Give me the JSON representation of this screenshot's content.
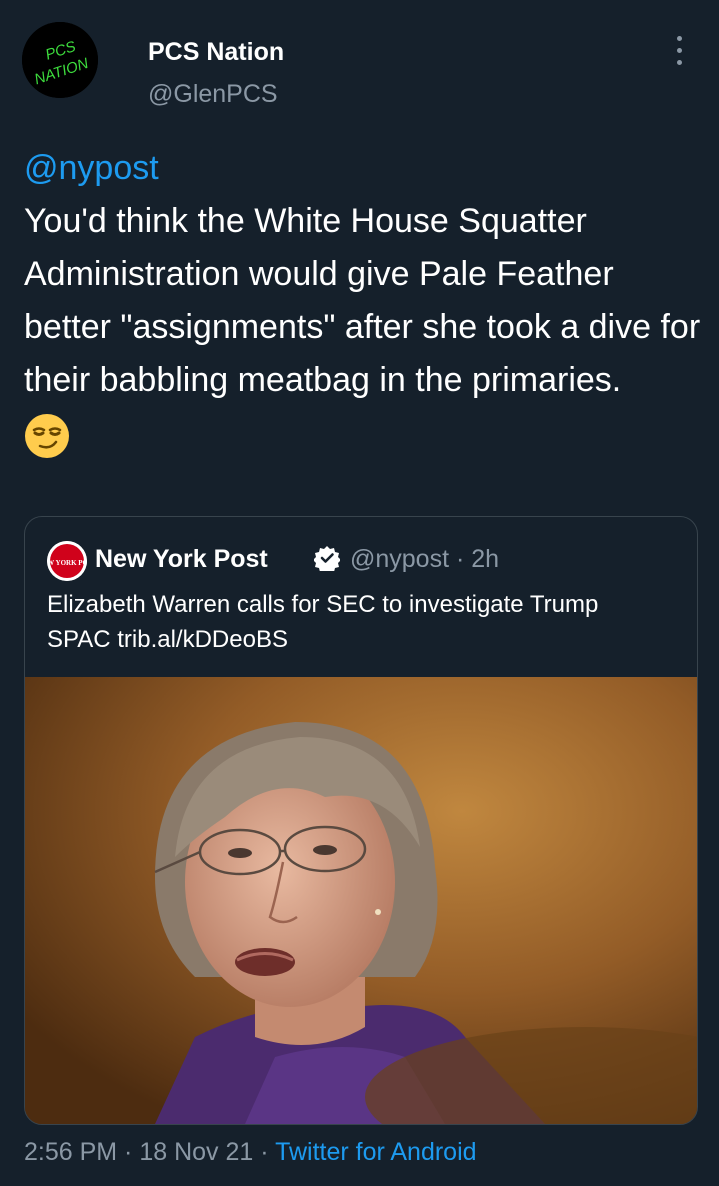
{
  "author": {
    "display_name": "PCS Nation",
    "handle": "@GlenPCS",
    "avatar_text_top": "PCS",
    "avatar_text_bottom": "NATION"
  },
  "tweet": {
    "mention": "@nypost",
    "body": "You'd think the White House Squatter Administration would give Pale Feather better \"assignments\" after she took a dive for their babbling meatbag in the primaries.",
    "emoji": "smirking-face-icon"
  },
  "quote": {
    "avatar_text": "NEW YORK POST",
    "display_name": "New York Post",
    "handle_time": "@nypost · 2h",
    "text": "Elizabeth Warren calls for SEC to investigate Trump SPAC trib.al/kDDeoBS"
  },
  "meta": {
    "time_date": "2:56 PM · 18 Nov 21 · ",
    "source": "Twitter for Android"
  },
  "colors": {
    "background": "#15202b",
    "link": "#1d9bf0",
    "secondary_text": "#8b98a5",
    "border": "#38444d"
  }
}
